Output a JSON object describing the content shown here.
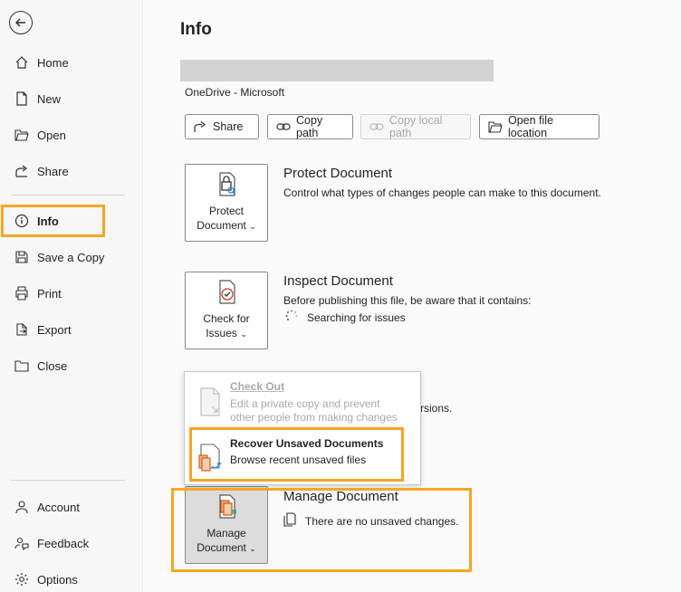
{
  "nav": {
    "items": [
      {
        "label": "Home",
        "icon": "home-icon"
      },
      {
        "label": "New",
        "icon": "new-document-icon"
      },
      {
        "label": "Open",
        "icon": "folder-open-icon"
      },
      {
        "label": "Share",
        "icon": "share-icon"
      },
      {
        "label": "Info",
        "icon": "info-icon",
        "selected": true
      },
      {
        "label": "Save a Copy",
        "icon": "save-copy-icon"
      },
      {
        "label": "Print",
        "icon": "print-icon"
      },
      {
        "label": "Export",
        "icon": "export-icon"
      },
      {
        "label": "Close",
        "icon": "close-folder-icon"
      }
    ],
    "bottom_items": [
      {
        "label": "Account",
        "icon": "account-icon"
      },
      {
        "label": "Feedback",
        "icon": "feedback-icon"
      },
      {
        "label": "Options",
        "icon": "gear-icon"
      }
    ]
  },
  "page": {
    "title": "Info",
    "location": "OneDrive - Microsoft"
  },
  "actions": {
    "share": "Share",
    "copy_path": "Copy path",
    "copy_local_path": "Copy local path",
    "open_file_location": "Open file location"
  },
  "protect": {
    "tile_line1": "Protect",
    "tile_line2": "Document",
    "title": "Protect Document",
    "desc": "Control what types of changes people can make to this document."
  },
  "inspect": {
    "tile_line1": "Check for",
    "tile_line2": "Issues",
    "title": "Inspect Document",
    "desc": "Before publishing this file, be aware that it contains:",
    "status": "Searching for issues"
  },
  "versions_partial": "rsions.",
  "dropdown": {
    "checkout_title": "Check Out",
    "checkout_desc1": "Edit a private copy and prevent",
    "checkout_desc2": "other people from making changes",
    "recover_title": "Recover Unsaved Documents",
    "recover_desc": "Browse recent unsaved files"
  },
  "manage": {
    "tile_line1": "Manage",
    "tile_line2": "Document",
    "title": "Manage Document",
    "desc": "There are no unsaved changes."
  },
  "colors": {
    "highlight": "#f5a623",
    "background": "#f7f7f7"
  }
}
